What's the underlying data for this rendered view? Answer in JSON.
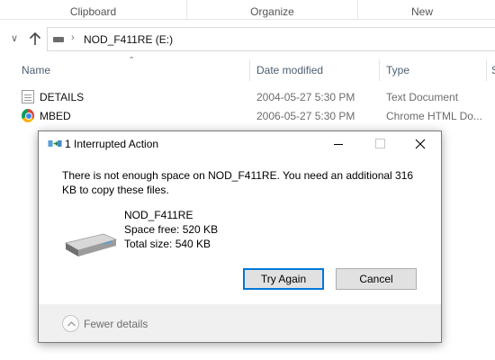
{
  "ribbon": {
    "groups": [
      "Clipboard",
      "Organize",
      "New"
    ]
  },
  "address_bar": {
    "drive_icon": "drive-icon",
    "path": "NOD_F411RE (E:)"
  },
  "columns": {
    "name": "Name",
    "date": "Date modified",
    "type": "Type",
    "size": "S"
  },
  "files": [
    {
      "name": "DETAILS",
      "date": "2004-05-27 5:30 PM",
      "type": "Text Document",
      "icon": "text-document-icon"
    },
    {
      "name": "MBED",
      "date": "2006-05-27 5:30 PM",
      "type": "Chrome HTML Do...",
      "icon": "chrome-icon"
    }
  ],
  "dialog": {
    "title": "1 Interrupted Action",
    "message": "There is not enough space on NOD_F411RE. You need an additional 316 KB to copy these files.",
    "drive_name": "NOD_F411RE",
    "space_free": "Space free: 520 KB",
    "total_size": "Total size: 540 KB",
    "try_again_label": "Try Again",
    "cancel_label": "Cancel",
    "details_label": "Fewer details",
    "accent_color": "#0078d7"
  }
}
